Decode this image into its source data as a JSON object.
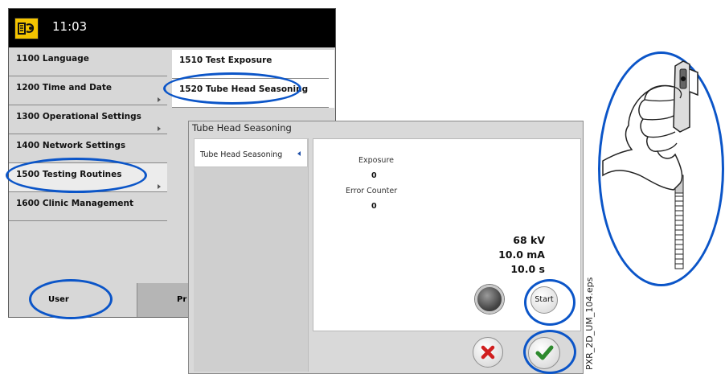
{
  "topbar": {
    "time": "11:03",
    "logo_icon": "wrench-book-icon",
    "logo_color": "#f4c400"
  },
  "menu": [
    {
      "label": "1100  Language",
      "has_arrow": false
    },
    {
      "label": "1200  Time and Date",
      "has_arrow": true
    },
    {
      "label": "1300  Operational Settings",
      "has_arrow": true
    },
    {
      "label": "1400  Network Settings",
      "has_arrow": false
    },
    {
      "label": "1500  Testing Routines",
      "has_arrow": true,
      "active": true
    },
    {
      "label": "1600  Clinic Management",
      "has_arrow": false
    }
  ],
  "submenu": [
    {
      "label": "1510  Test Exposure"
    },
    {
      "label": "1520  Tube Head Seasoning"
    }
  ],
  "bottom_tabs": {
    "user": "User",
    "pro": "Pr"
  },
  "dialog": {
    "title": "Tube Head Seasoning",
    "side_item": "Tube Head Seasoning",
    "exposure_label": "Exposure",
    "exposure_value": "0",
    "error_label": "Error Counter",
    "error_value": "0",
    "kv": "68 kV",
    "ma": "10.0 mA",
    "s": "10.0 s",
    "start_label": "Start",
    "cancel_icon": "close-icon",
    "confirm_icon": "check-icon"
  },
  "caption": "PXR_2D_UM_104.eps",
  "colors": {
    "highlight": "#0b55c8",
    "accent_green": "#2e8a2e",
    "cancel_red": "#d01e1e"
  }
}
